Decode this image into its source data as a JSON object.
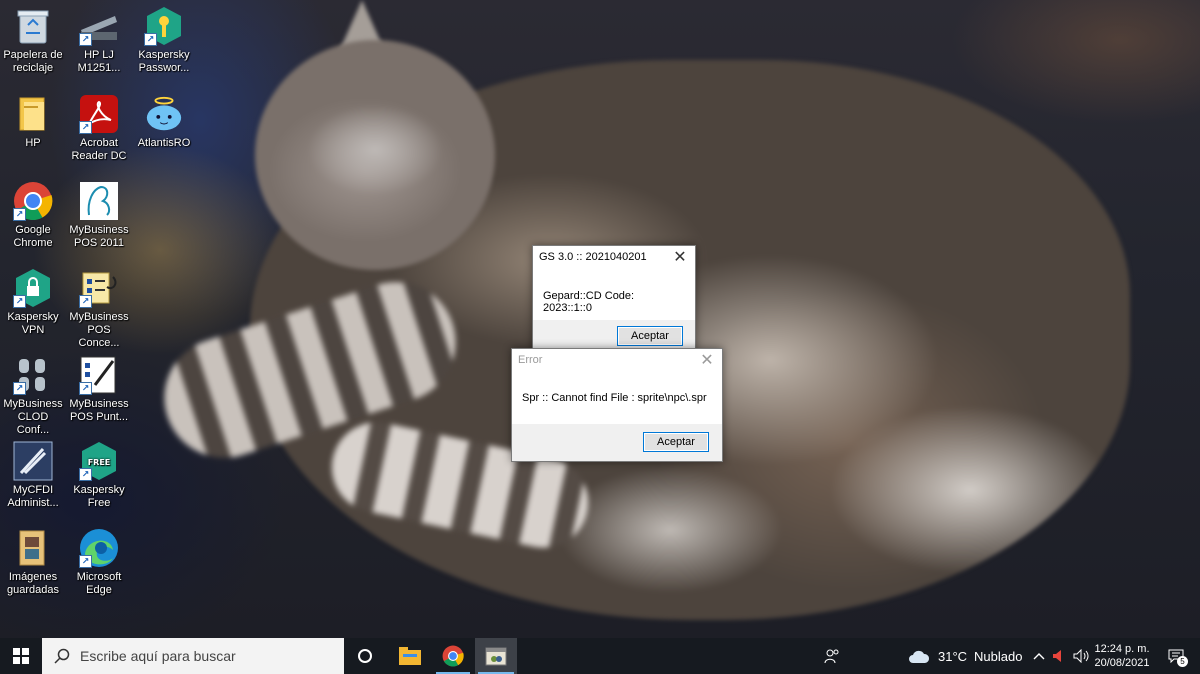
{
  "desktop": {
    "icons": [
      {
        "label": "Papelera de reciclaje",
        "icon": "recycle-bin-icon"
      },
      {
        "label": "HP LJ M1251...",
        "icon": "scanner-icon"
      },
      {
        "label": "Kaspersky Passwor...",
        "icon": "kaspersky-password-icon"
      },
      {
        "label": "HP",
        "icon": "folder-icon"
      },
      {
        "label": "Acrobat Reader DC",
        "icon": "acrobat-icon"
      },
      {
        "label": "AtlantisRO",
        "icon": "atlantisro-icon"
      },
      {
        "label": "Google Chrome",
        "icon": "chrome-icon"
      },
      {
        "label": "MyBusiness POS 2011",
        "icon": "mybusiness-pos-icon"
      },
      {
        "label": "Kaspersky VPN",
        "icon": "kaspersky-vpn-icon"
      },
      {
        "label": "MyBusiness POS Conce...",
        "icon": "mybusiness-concentrator-icon"
      },
      {
        "label": "MyBusiness CLOD Conf...",
        "icon": "database-icon"
      },
      {
        "label": "MyBusiness POS Punt...",
        "icon": "mybusiness-punto-icon"
      },
      {
        "label": "MyCFDI Administ...",
        "icon": "mycfdi-icon"
      },
      {
        "label": "Kaspersky Free",
        "icon": "kaspersky-free-icon"
      },
      {
        "label": "Imágenes guardadas",
        "icon": "pictures-folder-icon"
      },
      {
        "label": "Microsoft Edge",
        "icon": "edge-icon"
      }
    ]
  },
  "dialog_gs": {
    "title": "GS 3.0 :: 2021040201",
    "message": "Gepard::CD Code: 2023::1::0",
    "button": "Aceptar",
    "close": "✕"
  },
  "dialog_error": {
    "title": "Error",
    "message": "Spr :: Cannot find File : sprite\\npc\\.spr",
    "button": "Aceptar",
    "close": "✕"
  },
  "taskbar": {
    "search_placeholder": "Escribe aquí para buscar",
    "weather_temp": "31°C",
    "weather_desc": "Nublado",
    "time": "12:24 p. m.",
    "date": "20/08/2021",
    "notification_count": "5",
    "accent": "#76b9ed"
  }
}
